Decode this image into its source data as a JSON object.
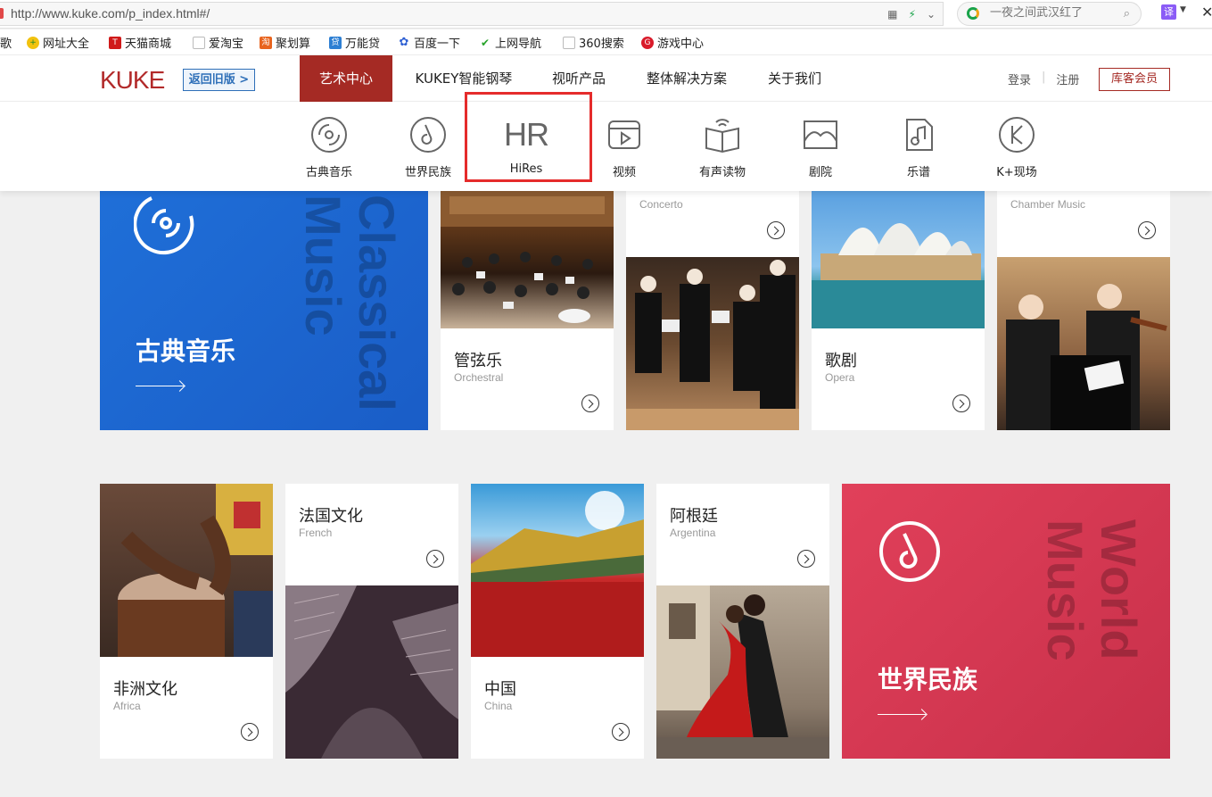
{
  "browser": {
    "url": "http://www.kuke.com/p_index.html#/",
    "search_placeholder": "一夜之间武汉红了",
    "translate_label": "译",
    "bookmarks": [
      "歌",
      "网址大全",
      "天猫商城",
      "爱淘宝",
      "聚划算",
      "万能贷",
      "百度一下",
      "上网导航",
      "360搜索",
      "游戏中心"
    ]
  },
  "header": {
    "logo": "KUKE",
    "back_label": "返回旧版 >",
    "nav": [
      "艺术中心",
      "KUKEY智能钢琴",
      "视听产品",
      "整体解决方案",
      "关于我们"
    ],
    "login": "登录",
    "register": "注册",
    "member": "库客会员"
  },
  "submenu": {
    "items": [
      "古典音乐",
      "世界民族",
      "HiRes",
      "视频",
      "有声读物",
      "剧院",
      "乐谱",
      "K+现场"
    ],
    "hires_mark": "HR"
  },
  "cards": {
    "classical": {
      "title": "古典音乐",
      "word1": "Classical",
      "word2": "Music"
    },
    "orchestral": {
      "title": "管弦乐",
      "sub": "Orchestral"
    },
    "concerto": {
      "sub": "Concerto"
    },
    "opera": {
      "title": "歌剧",
      "sub": "Opera"
    },
    "chamber": {
      "sub": "Chamber Music"
    },
    "africa": {
      "title": "非洲文化",
      "sub": "Africa"
    },
    "french": {
      "title": "法国文化",
      "sub": "French"
    },
    "china": {
      "title": "中国",
      "sub": "China"
    },
    "argentina": {
      "title": "阿根廷",
      "sub": "Argentina"
    },
    "world": {
      "title": "世界民族",
      "word1": "World",
      "word2": "Music"
    }
  },
  "colors": {
    "brand_red": "#a52a24",
    "classical_blue": "#1f6fd8",
    "world_red": "#e1405a",
    "highlight": "#e52b2b"
  }
}
